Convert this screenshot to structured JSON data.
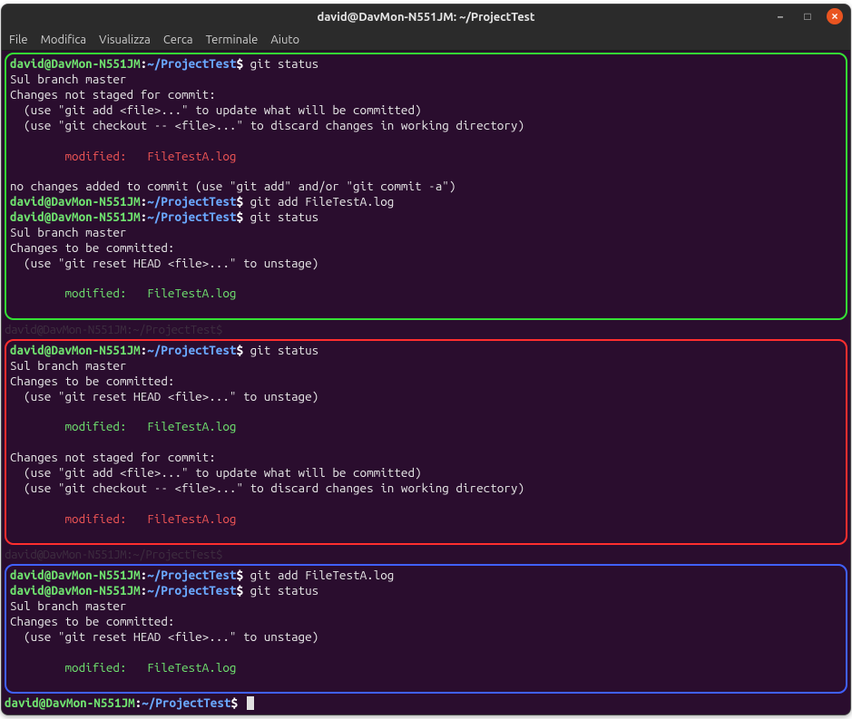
{
  "window": {
    "title": "david@DavMon-N551JM: ~/ProjectTest"
  },
  "menu": {
    "file": "File",
    "edit": "Modifica",
    "view": "Visualizza",
    "search": "Cerca",
    "terminal": "Terminale",
    "help": "Aiuto"
  },
  "prompt": {
    "user": "david@DavMon-N551JM",
    "colon": ":",
    "path": "~/ProjectTest",
    "dollar": "$"
  },
  "cmd": {
    "git_status": " git status",
    "git_add_a": " git add FileTestA.log"
  },
  "out": {
    "sul_branch": "Sul branch master",
    "changes_not_staged": "Changes not staged for commit:",
    "use_add": "  (use \"git add <file>...\" to update what will be committed)",
    "use_checkout": "  (use \"git checkout -- <file>...\" to discard changes in working directory)",
    "mod_label": "        modified:   FileTestA.log",
    "no_changes": "no changes added to commit (use \"git add\" and/or \"git commit -a\")",
    "changes_to_commit": "Changes to be committed:",
    "use_reset": "  (use \"git reset HEAD <file>...\" to unstage)",
    "obscured": "david@DavMon-N551JM:~/ProjectTest$"
  }
}
